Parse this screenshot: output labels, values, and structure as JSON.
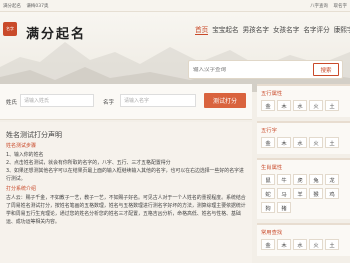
{
  "topbar": {
    "left": [
      "满分起名",
      "谦梅037奥"
    ],
    "right": [
      "八字查询",
      "取名字"
    ]
  },
  "logo": {
    "seal": "名字",
    "text": "满分起名"
  },
  "nav": [
    "首页",
    "宝宝起名",
    "男孩名字",
    "女孩名字",
    "名字评分",
    "康熙字典"
  ],
  "search": {
    "placeholder": "输入汉字查询",
    "button": "搜索"
  },
  "form": {
    "surname_label": "姓氏",
    "surname_placeholder": "请输入姓氏",
    "name_label": "名字",
    "name_placeholder": "请输入名字",
    "submit": "测试打分"
  },
  "article": {
    "heading": "姓名测试打分声明",
    "section1": "姓名测试步骤",
    "steps": [
      "1、输入你的姓名",
      "2、点击姓名测试，就会有你所取的名字的，八字、五行、三才五格配置得分",
      "3、如果还想测其他名字可以在结果页最上面的输入框继续输入其他的名字，也可以在右边选择一些好的名字进行测试。"
    ],
    "section2": "打分系统介绍",
    "intro": "古人云：赐子千金，不如教子一艺，教子一艺，不如赐子好名。可见古人对于一个人姓名的重视程度。系统结合了周易姓名测试打分，按姓名笔画的五格数理，姓名与五格数理进行测名字好坏的方法，测算综理主要依据统计学和周易五行生克理论，通过您的姓名分析您的姓名三才配置，五格吉凶分析，命格高低、姓名与性格、基础运、成功运等相关内容。"
  },
  "sidebar": {
    "wuxing_title": "五行属性",
    "wuxing": [
      "金",
      "木",
      "水",
      "火",
      "土"
    ],
    "wuxing2_title": "五行字",
    "wuxing2": [
      "金",
      "木",
      "水",
      "火",
      "土"
    ],
    "zodiac_title": "生肖属性",
    "zodiac": [
      "鼠",
      "牛",
      "虎",
      "兔",
      "龙",
      "蛇",
      "马",
      "羊",
      "猴",
      "鸡",
      "狗",
      "猪"
    ],
    "common_title": "常用查找",
    "common": [
      "金",
      "木",
      "水",
      "火",
      "土"
    ]
  }
}
